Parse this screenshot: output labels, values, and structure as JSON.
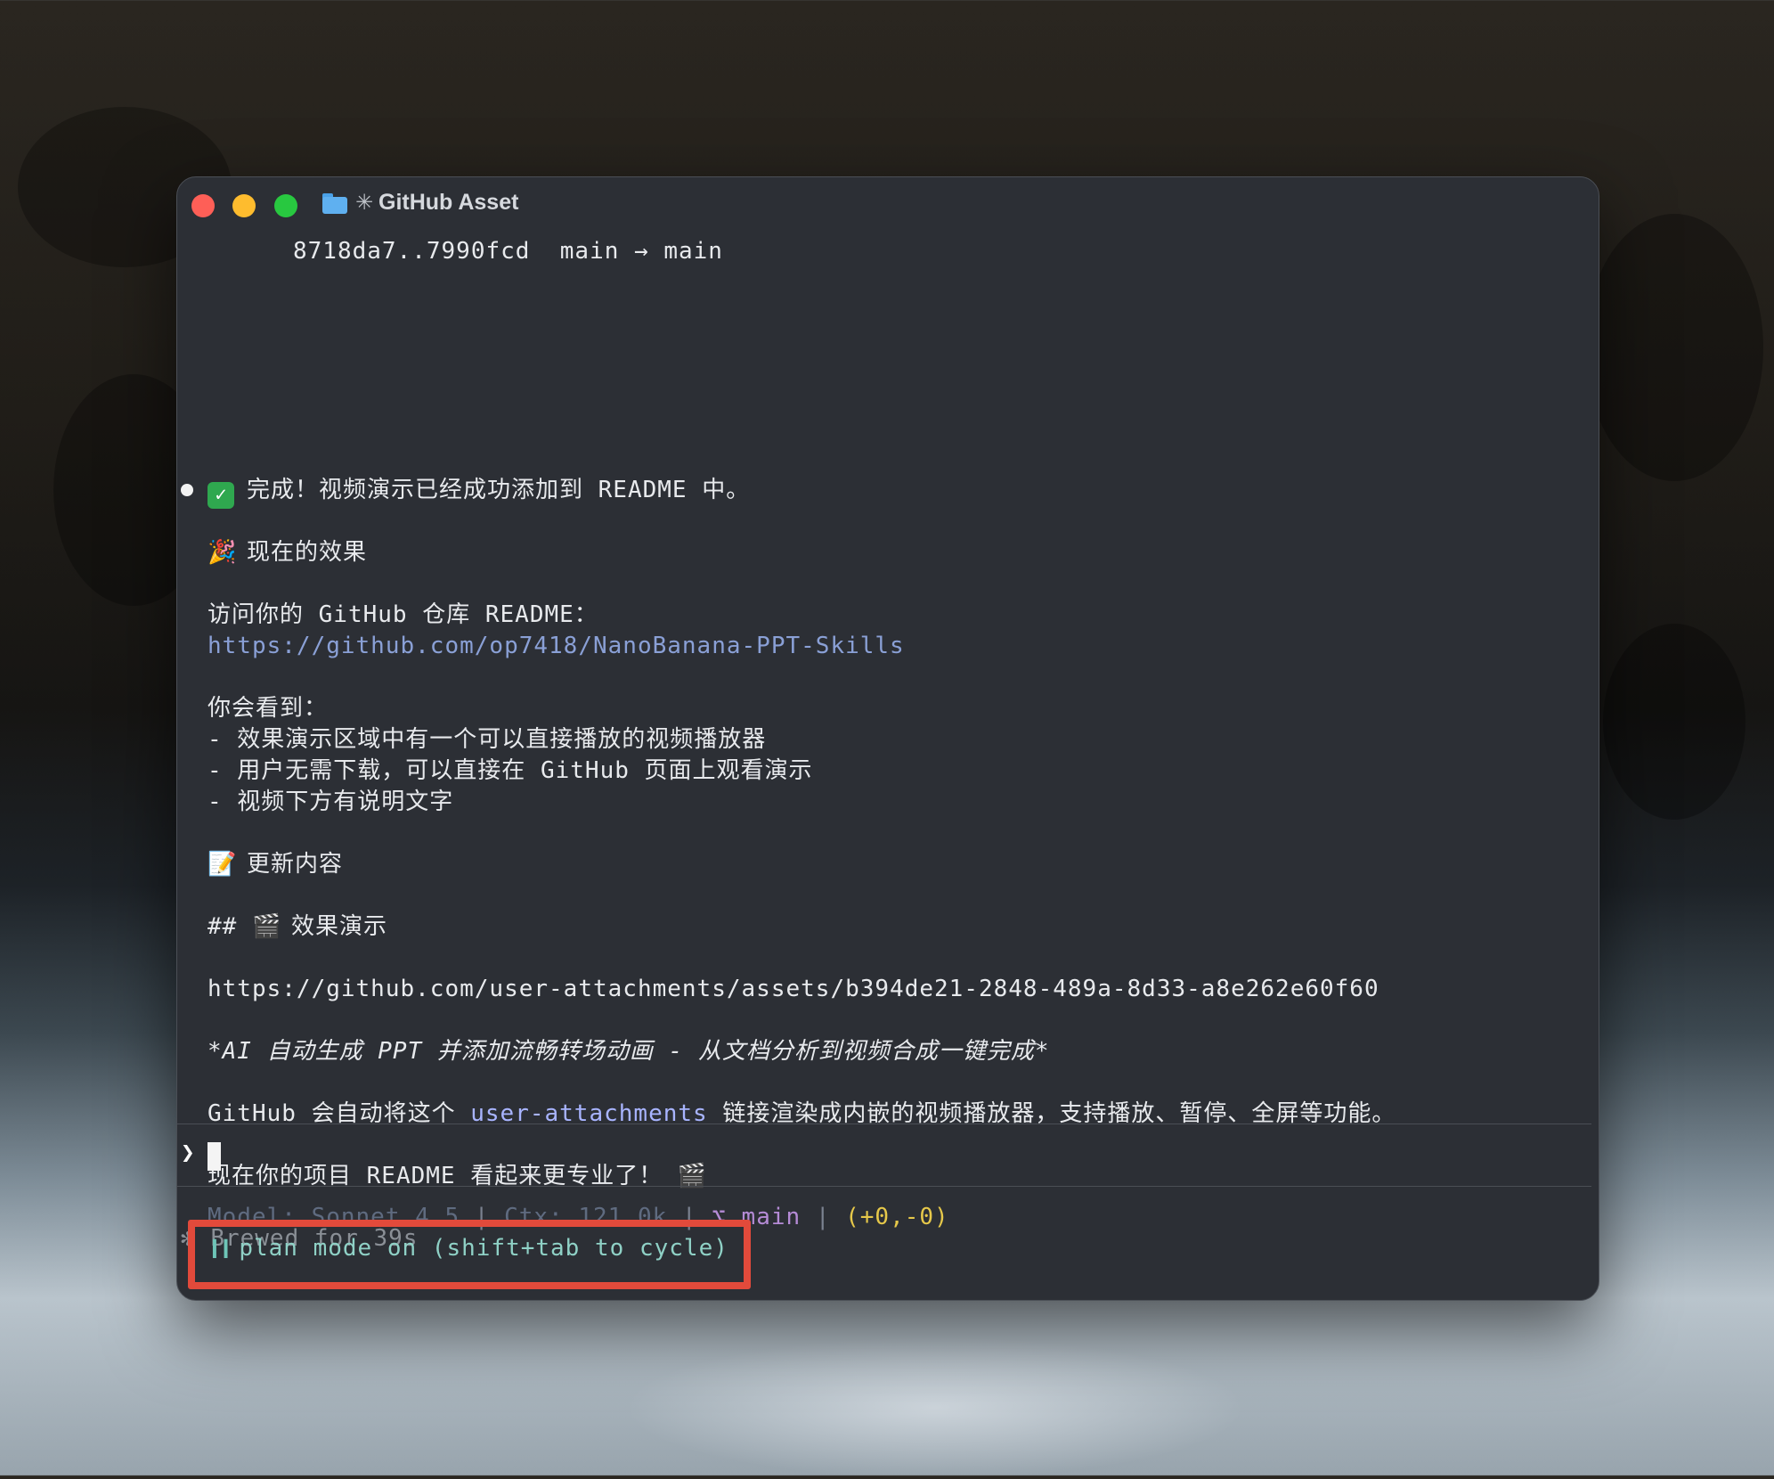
{
  "window": {
    "title": "GitHub Asset",
    "title_prefix_icon": "asterisk-icon"
  },
  "output": {
    "git_line": "8718da7..7990fcd  main → main",
    "done_line": "完成！视频演示已经成功添加到 README 中。",
    "effect_heading": "现在的效果",
    "visit_line": "访问你的 GitHub 仓库 README：",
    "repo_url": "https://github.com/op7418/NanoBanana-PPT-Skills",
    "you_will_see": "你会看到：",
    "bullets": [
      "- 效果演示区域中有一个可以直接播放的视频播放器",
      "- 用户无需下载，可以直接在 GitHub 页面上观看演示",
      "- 视频下方有说明文字"
    ],
    "update_heading": "更新内容",
    "md_heading_prefix": "##",
    "md_heading_text": "效果演示",
    "asset_url": "https://github.com/user-attachments/assets/b394de21-2848-489a-8d33-a8e262e60f60",
    "italic_line": "*AI 自动生成 PPT 并添加流畅转场动画 - 从文档分析到视频合成一键完成*",
    "github_line_pre": "GitHub 会自动将这个 ",
    "github_line_hl": "user-attachments",
    "github_line_post": " 链接渲染成内嵌的视频播放器，支持播放、暂停、全屏等功能。",
    "final_line": "现在你的项目 README 看起来更专业了！",
    "brewed": "Brewed for 39s"
  },
  "prompt": {
    "symbol": "❯"
  },
  "statusbar": {
    "model": "Model: Sonnet 4.5",
    "ctx": "Ctx: 121.0k",
    "branch": "⌥ main",
    "diff": "(+0,-0)",
    "separator": "|"
  },
  "plan_mode": {
    "text": "plan mode on (shift+tab to cycle)"
  },
  "colors": {
    "window_bg": "#2c2f35",
    "link": "#8aa0d6",
    "highlight": "#a8b4ff",
    "plan_mode": "#8fd1c6",
    "diff": "#e6c84a",
    "callout": "#e24a3b"
  }
}
